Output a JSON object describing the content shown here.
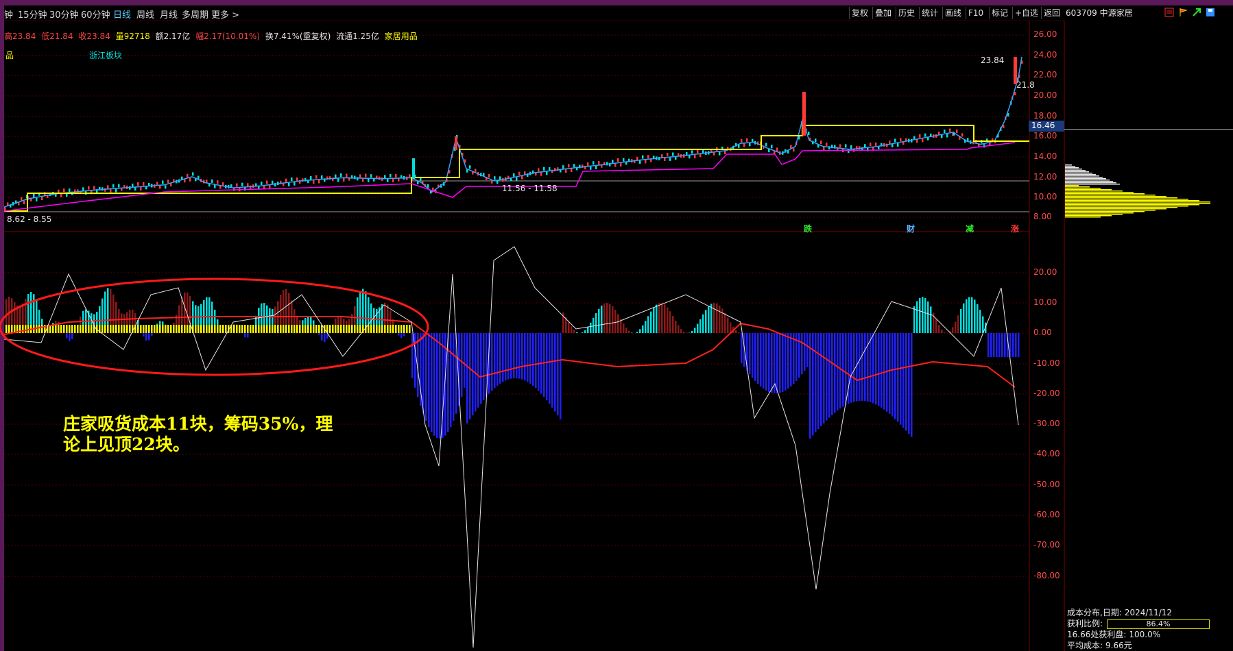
{
  "toolbar": {
    "periods": [
      "钟",
      "15分钟",
      "30分钟",
      "60分钟",
      "日线",
      "周线",
      "月线",
      "多周期",
      "更多 >"
    ],
    "buttons": [
      "复权",
      "叠加",
      "历史",
      "统计",
      "画线",
      "F10",
      "标记",
      "+自选",
      "返回"
    ]
  },
  "stock": {
    "code_name": "603709 中源家居"
  },
  "info": {
    "high": "高23.84",
    "low": "低21.84",
    "close": "收23.84",
    "volume": "量92718",
    "amount": "额2.17亿",
    "change": "幅2.17(10.01%)",
    "turnover": "换7.41%(重复权)",
    "float": "流通1.25亿",
    "sector": "家居用品"
  },
  "labels": {
    "product_tag": "品",
    "region": "浙江板块",
    "range_low": "11.56 - 11.58",
    "range_start": "8.62 - 8.55",
    "price_23": "23.84",
    "price_21": "21.8",
    "current_price": "16.46"
  },
  "markers": [
    {
      "text": "跌",
      "color": "#2ee82e"
    },
    {
      "text": "财",
      "color": "#5ab4ff"
    },
    {
      "text": "减",
      "color": "#2ee82e"
    },
    {
      "text": "涨",
      "color": "#ff3a3a"
    }
  ],
  "price_axis": [
    "26.00",
    "24.00",
    "22.00",
    "20.00",
    "18.00",
    "16.00",
    "14.00",
    "12.00",
    "10.00",
    "8.00"
  ],
  "osc_axis": [
    "20.00",
    "10.00",
    "0.00",
    "-10.00",
    "-20.00",
    "-30.00",
    "-40.00",
    "-50.00",
    "-60.00",
    "-70.00",
    "-80.00"
  ],
  "annotation": {
    "line1": "庄家吸货成本11块，筹码35%，理",
    "line2": "论上见顶22块。"
  },
  "cost": {
    "date_label": "成本分布,日期:",
    "date": "2024/11/12",
    "profit_label": "获利比例:",
    "profit_value": "86.4%",
    "profit_ratio": 0.864,
    "profit_at_label": "16.66处获利盘:",
    "profit_at_value": "100.0%",
    "avg_label": "平均成本:",
    "avg_value": "9.66元"
  },
  "colors": {
    "up": "#ff3a3a",
    "down": "#00e0e0",
    "ma_yellow": "#ffff00",
    "ma_magenta": "#ff00ff",
    "blue_bars": "#2020ff",
    "ellipse": "#ff1a1a"
  }
}
